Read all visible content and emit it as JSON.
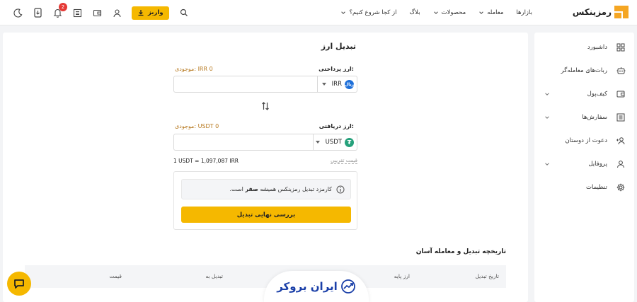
{
  "header": {
    "logo_text": "رمزینکس",
    "nav": [
      {
        "label": "بازارها",
        "has_caret": false
      },
      {
        "label": "معامله",
        "has_caret": true
      },
      {
        "label": "محصولات",
        "has_caret": true
      },
      {
        "label": "بلاگ",
        "has_caret": false
      },
      {
        "label": "از کجا شروع کنیم؟",
        "has_caret": true
      }
    ],
    "deposit_label": "واریز",
    "notification_count": "2",
    "icons": [
      "search-icon",
      "user-icon",
      "wallet-icon",
      "orders-icon",
      "notification-icon",
      "download-app-icon",
      "dark-mode-icon"
    ]
  },
  "sidebar": {
    "items": [
      {
        "label": "داشبورد",
        "icon": "dashboard-icon",
        "has_caret": false
      },
      {
        "label": "ربات‌های معامله‌گر",
        "icon": "robot-icon",
        "has_caret": false
      },
      {
        "label": "کیف‌پول",
        "icon": "wallet-icon",
        "has_caret": true
      },
      {
        "label": "سفارش‌ها",
        "icon": "orders-icon",
        "has_caret": true
      },
      {
        "label": "دعوت از دوستان",
        "icon": "invite-icon",
        "has_caret": false
      },
      {
        "label": "پروفایل",
        "icon": "profile-icon",
        "has_caret": true
      },
      {
        "label": "تنظیمات",
        "icon": "settings-icon",
        "has_caret": false
      }
    ]
  },
  "converter": {
    "title": "تبدیل ارز",
    "pay": {
      "label": "ارز پرداختی:",
      "balance": "موجودی: IRR 0",
      "currency": "IRR",
      "currency_icon_text": "ریال",
      "value": ""
    },
    "receive": {
      "label": "ارز دریافتی:",
      "balance": "موجودی: USDT 0",
      "currency": "USDT",
      "currency_icon_text": "₮",
      "value": ""
    },
    "rate": "1 USDT = 1,097,087 IRR",
    "approx_label": "قیمت تقریبی",
    "notice_prefix": "کارمزد تبدیل رمزینکس همیشه",
    "notice_bold": "صفر",
    "notice_suffix": "است.",
    "submit_label": "بررسی نهایی تبدیل"
  },
  "history": {
    "title": "تاریخچه تبدیل و معامله آسان",
    "columns": [
      "تاریخ تبدیل",
      "ارز پایه",
      "تبدیل به",
      "قیمت"
    ]
  },
  "watermark": {
    "text": "ایران بروکر"
  },
  "colors": {
    "accent": "#f5b800",
    "balance": "#b7791f",
    "badge": "#e53935",
    "tether": "#26a17b",
    "rial": "#1e6fd9"
  }
}
